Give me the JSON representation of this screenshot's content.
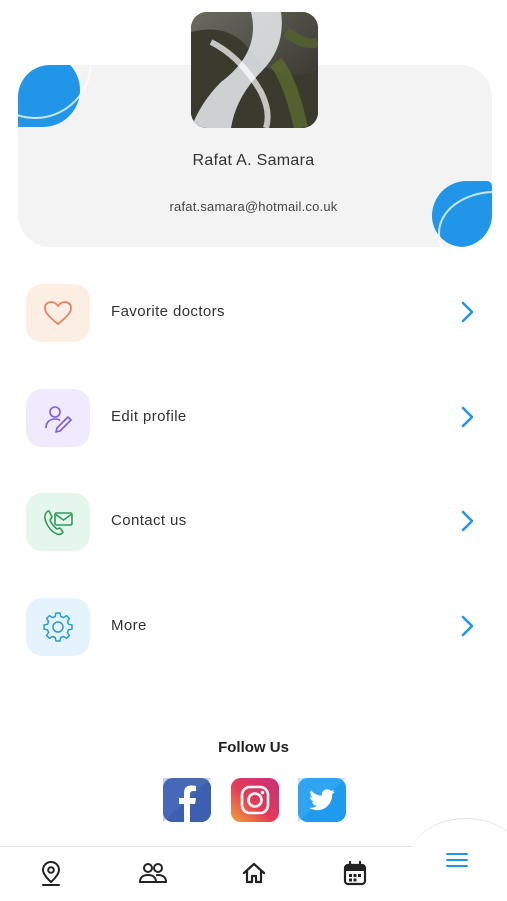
{
  "profile": {
    "name": "Rafat A. Samara",
    "email": "rafat.samara@hotmail.co.uk"
  },
  "menu": [
    {
      "label": "Favorite doctors",
      "icon": "heart-icon",
      "bg": "#fdeee4",
      "color": "#e8835a"
    },
    {
      "label": "Edit profile",
      "icon": "user-edit-icon",
      "bg": "#efeafd",
      "color": "#7b5be0"
    },
    {
      "label": "Contact us",
      "icon": "phone-mail-icon",
      "bg": "#e5f6ec",
      "color": "#2f9a5a"
    },
    {
      "label": "More",
      "icon": "gear-icon",
      "bg": "#e5f4fc",
      "color": "#2a98d8"
    }
  ],
  "follow": {
    "title": "Follow Us",
    "networks": [
      "facebook-icon",
      "instagram-icon",
      "twitter-icon"
    ]
  },
  "nav": [
    "location-pin-icon",
    "people-icon",
    "home-icon",
    "calendar-icon",
    "menu-icon"
  ],
  "colors": {
    "accent": "#2196e8",
    "card": "#f3f3f3"
  }
}
